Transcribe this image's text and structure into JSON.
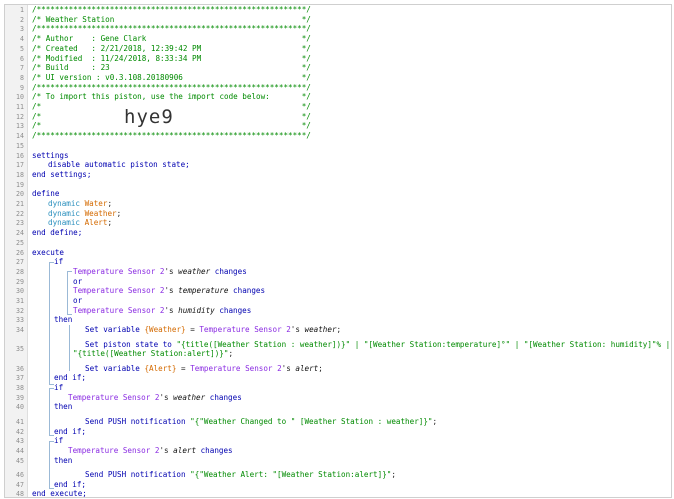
{
  "header": [
    "/***********************************************************/",
    "/* Weather Station                                         */",
    "/***********************************************************/",
    "/* Author    : Gene Clark                                  */",
    "/* Created   : 2/21/2018, 12:39:42 PM                      */",
    "/* Modified  : 11/24/2018, 8:33:34 PM                      */",
    "/* Build     : 23                                          */",
    "/* UI version : v0.3.108.20180906                          */",
    "/***********************************************************/",
    "/* To import this piston, use the import code below:       */",
    "/*                                                         */",
    "/*                                                         */",
    "/*                                                         */",
    "/***********************************************************/"
  ],
  "import_code": "hye9",
  "keywords": {
    "settings": "settings",
    "disable": "disable automatic piston state;",
    "end_settings": "end settings;",
    "define": "define",
    "dynamic": "dynamic",
    "end_define": "end define;",
    "execute": "execute",
    "if": "if",
    "or": "or",
    "then": "then",
    "end_if": "end if;",
    "end_execute": "end execute;",
    "set_variable": "Set variable",
    "set_piston_state": "Set piston state to",
    "send_push": "Send PUSH notification",
    "s": "'s",
    "changes": "changes",
    "eq": "=",
    "semicolon": ";"
  },
  "variables": {
    "water": "Water",
    "weather": "Weather",
    "alert": "Alert",
    "water_braced": "{Weather}",
    "alert_braced": "{Alert}"
  },
  "device": "Temperature Sensor 2",
  "attributes": {
    "weather": "weather",
    "temperature": "temperature",
    "humidity": "humidity",
    "alert": "alert"
  },
  "strings": {
    "state_1": "\"{title([Weather Station : weather])}\" | \"[Weather Station:temperature]°\" | \"[Weather Station: humidity]\"% |",
    "state_2": "\"{title([Weather Station:alert])}\"",
    "state_end": ";",
    "push_weather": "\"{\"Weather Changed to \" [Weather Station : weather]}\"",
    "push_alert": "\"{\"Weather Alert: \"[Weather Station:alert]}\""
  },
  "line_numbers": [
    "1",
    "2",
    "3",
    "4",
    "5",
    "6",
    "7",
    "8",
    "9",
    "10",
    "11",
    "12",
    "13",
    "14",
    "15",
    "16",
    "17",
    "18",
    "19",
    "20",
    "21",
    "22",
    "23",
    "24",
    "25",
    "26",
    "27",
    "28",
    "29",
    "30",
    "31",
    "32",
    "33",
    "34",
    "35",
    "36",
    "37",
    "38",
    "39",
    "40",
    "41",
    "42",
    "43",
    "44",
    "45",
    "46",
    "47",
    "48"
  ]
}
